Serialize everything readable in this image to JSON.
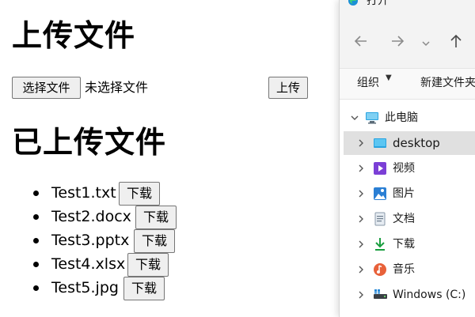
{
  "webpage": {
    "upload_heading": "上传文件",
    "choose_file_button": "选择文件",
    "no_file_chosen": "未选择文件",
    "upload_button": "上传",
    "uploaded_heading": "已上传文件",
    "files": [
      {
        "name": "Test1.txt",
        "download_label": "下载"
      },
      {
        "name": "Test2.docx",
        "download_label": "下载"
      },
      {
        "name": "Test3.pptx",
        "download_label": "下载"
      },
      {
        "name": "Test4.xlsx",
        "download_label": "下载"
      },
      {
        "name": "Test5.jpg",
        "download_label": "下载"
      }
    ]
  },
  "dialog": {
    "title": "打开",
    "app_icon": "edge-browser-icon",
    "toolbar": {
      "organize_label": "组织",
      "new_folder_label": "新建文件夹"
    },
    "tree": {
      "root_label": "此电脑",
      "items": [
        {
          "label": "desktop",
          "icon": "desktop-folder-icon",
          "selected": true
        },
        {
          "label": "视频",
          "icon": "videos-icon",
          "selected": false
        },
        {
          "label": "图片",
          "icon": "pictures-icon",
          "selected": false
        },
        {
          "label": "文档",
          "icon": "documents-icon",
          "selected": false
        },
        {
          "label": "下载",
          "icon": "downloads-icon",
          "selected": false
        },
        {
          "label": "音乐",
          "icon": "music-icon",
          "selected": false
        },
        {
          "label": "Windows (C:)",
          "icon": "windows-drive-icon",
          "selected": false
        }
      ]
    }
  },
  "colors": {
    "selection": "#e0e0e0",
    "dialog_chrome": "#f3f3f3",
    "button_face": "#efefef",
    "download_arrow": "#1a9e3f",
    "music_icon": "#e8613a",
    "videos_icon": "#7b3fd6",
    "pictures_icon": "#2a7fd4",
    "desktop_icon": "#2aa4e0"
  }
}
